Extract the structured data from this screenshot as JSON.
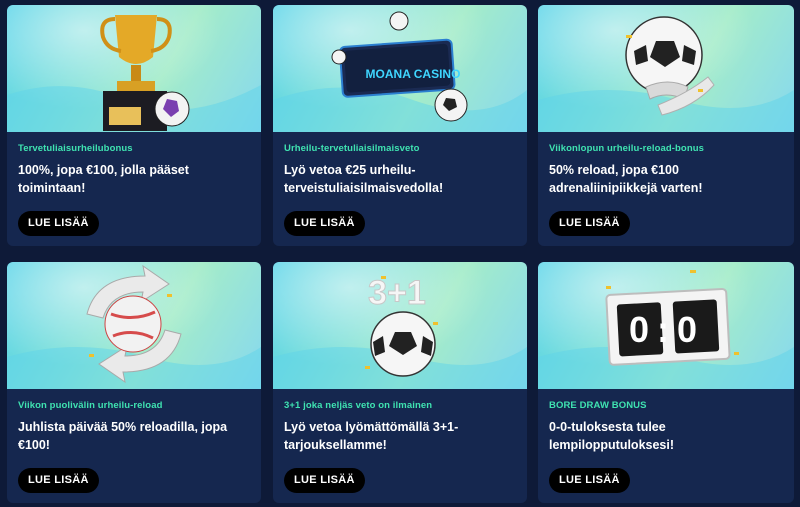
{
  "cards": [
    {
      "category": "Tervetuliaisurheilubonus",
      "description": "100%, jopa €100, jolla pääset toimintaan!",
      "button": "LUE LISÄÄ",
      "image": "trophy-with-football"
    },
    {
      "category": "Urheilu-tervetuliaisilmaisveto",
      "description": "Lyö vetoa €25 urheilu-terveistuliaisilmaisvedolla!",
      "button": "LUE LISÄÄ",
      "image": "moana-casino-ticket",
      "image_text": "MOANA CASINO"
    },
    {
      "category": "Viikonlopun urheilu-reload-bonus",
      "description": "50% reload, jopa €100 adrenaliinipiikkejä varten!",
      "button": "LUE LISÄÄ",
      "image": "football-with-reload-arrows"
    },
    {
      "category": "Viikon puolivälin urheilu-reload",
      "description": "Juhlista päivää 50% reloadilla, jopa €100!",
      "button": "LUE LISÄÄ",
      "image": "volleyball-with-reload-arrows"
    },
    {
      "category": "3+1 joka neljäs veto on ilmainen",
      "description": "Lyö vetoa lyömättömällä 3+1-tarjouksellamme!",
      "button": "LUE LISÄÄ",
      "image": "football-3-plus-1",
      "image_text": "3+1"
    },
    {
      "category": "BORE DRAW BONUS",
      "description": "0-0-tuloksesta tulee lempilopputuloksesi!",
      "button": "LUE LISÄÄ",
      "image": "scoreboard-0-0",
      "image_text": "0:0"
    }
  ],
  "colors": {
    "page_bg": "#0e1a38",
    "card_bg": "#15274f",
    "category": "#3fe3b1",
    "button_bg": "#000000"
  }
}
